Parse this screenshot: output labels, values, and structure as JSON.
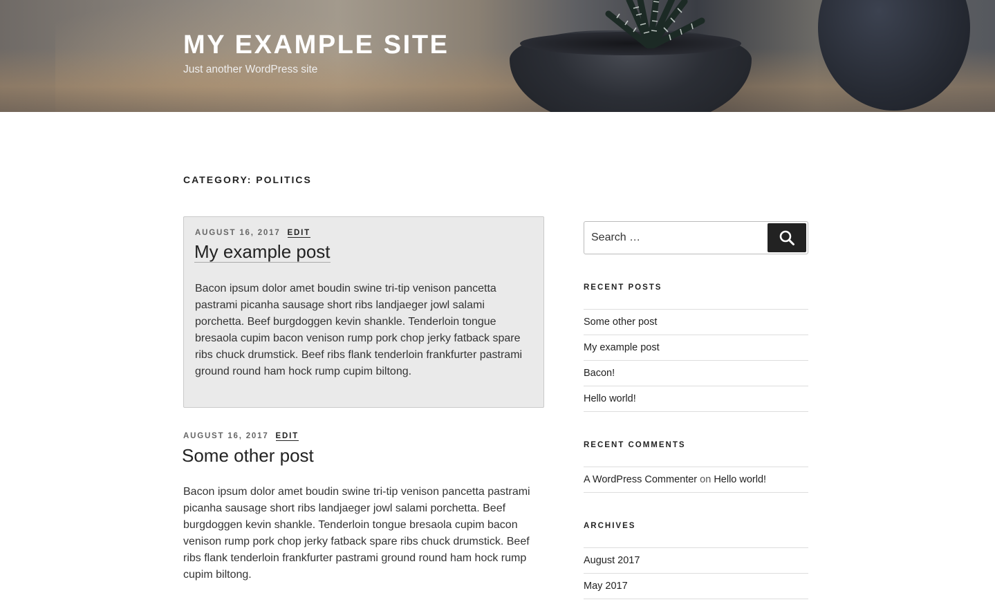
{
  "header": {
    "site_title": "MY EXAMPLE SITE",
    "site_description": "Just another WordPress site"
  },
  "page_title": "CATEGORY: POLITICS",
  "posts": [
    {
      "date": "AUGUST 16, 2017",
      "edit_label": "EDIT",
      "title": "My example post",
      "excerpt": "Bacon ipsum dolor amet boudin swine tri-tip venison pancetta pastrami picanha sausage short ribs landjaeger jowl salami porchetta. Beef burgdoggen kevin shankle. Tenderloin tongue bresaola cupim bacon venison rump pork chop jerky fatback spare ribs chuck drumstick. Beef ribs flank tenderloin frankfurter pastrami ground round ham hock rump cupim biltong."
    },
    {
      "date": "AUGUST 16, 2017",
      "edit_label": "EDIT",
      "title": "Some other post",
      "excerpt": "Bacon ipsum dolor amet boudin swine tri-tip venison pancetta pastrami picanha sausage short ribs landjaeger jowl salami porchetta. Beef burgdoggen kevin shankle. Tenderloin tongue bresaola cupim bacon venison rump pork chop jerky fatback spare ribs chuck drumstick. Beef ribs flank tenderloin frankfurter pastrami ground round ham hock rump cupim biltong."
    }
  ],
  "sidebar": {
    "search": {
      "placeholder": "Search …",
      "button_icon": "search-icon"
    },
    "recent_posts": {
      "title": "RECENT POSTS",
      "items": [
        "Some other post",
        "My example post",
        "Bacon!",
        "Hello world!"
      ]
    },
    "recent_comments": {
      "title": "RECENT COMMENTS",
      "items": [
        {
          "author": "A WordPress Commenter",
          "connector": "on",
          "post": "Hello world!"
        }
      ]
    },
    "archives": {
      "title": "ARCHIVES",
      "items": [
        "August 2017",
        "May 2017"
      ]
    }
  }
}
